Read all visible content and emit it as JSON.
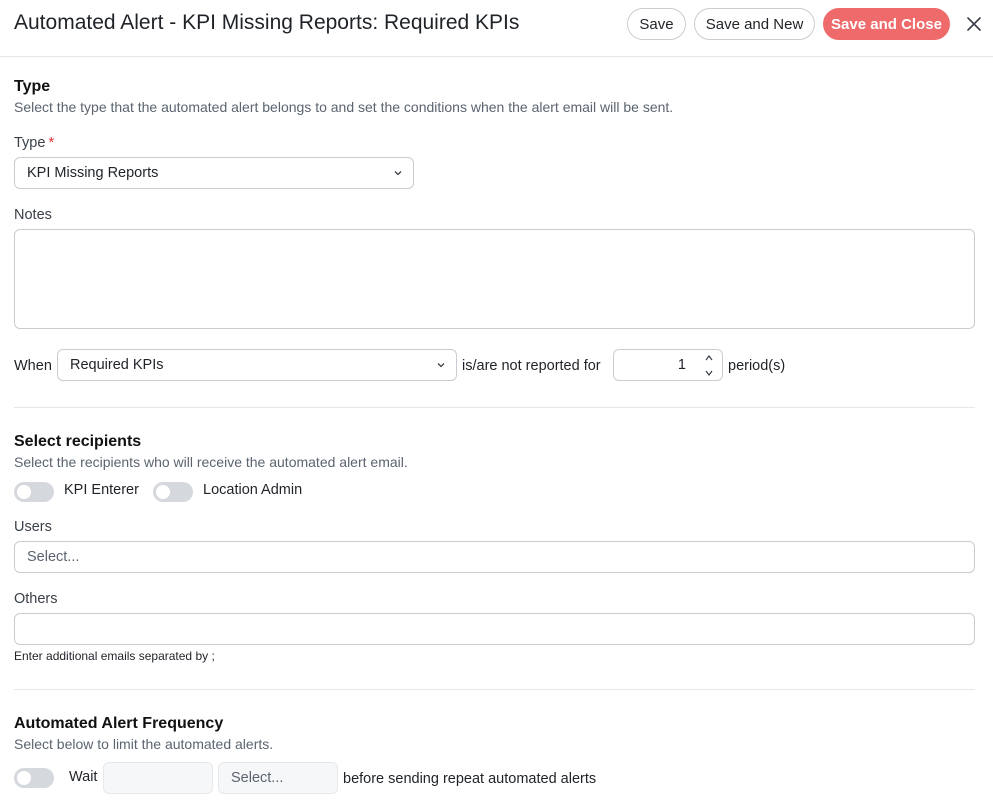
{
  "header": {
    "title": "Automated Alert - KPI Missing Reports: Required KPIs",
    "save_label": "Save",
    "save_new_label": "Save and New",
    "save_close_label": "Save and Close",
    "close_icon": "close-icon"
  },
  "type_section": {
    "title": "Type",
    "description": "Select the type that the automated alert belongs to and set the conditions when the alert email will be sent.",
    "type_label": "Type",
    "required_mark": "*",
    "type_value": "KPI Missing Reports",
    "notes_label": "Notes",
    "notes_value": "",
    "when_label": "When",
    "when_value": "Required KPIs",
    "not_reported_text": "is/are not reported for",
    "periods_value": "1",
    "periods_text": "period(s)"
  },
  "recipients_section": {
    "title": "Select recipients",
    "description": "Select the recipients who will receive the automated alert email.",
    "toggles": [
      {
        "label": "KPI Enterer",
        "on": false
      },
      {
        "label": "Location Admin",
        "on": false
      }
    ],
    "users_label": "Users",
    "users_placeholder": "Select...",
    "others_label": "Others",
    "others_value": "",
    "others_hint": "Enter additional emails separated by ;"
  },
  "frequency_section": {
    "title": "Automated Alert Frequency",
    "description": "Select below to limit the automated alerts.",
    "wait_toggle_on": false,
    "wait_label": "Wait",
    "wait_value": "",
    "unit_placeholder": "Select...",
    "trailing_text": "before sending repeat automated alerts"
  },
  "colors": {
    "primary": "#ef6b6b",
    "border": "#c9cdd2",
    "toggle_off": "#d5d8dc",
    "required": "#e03131"
  }
}
